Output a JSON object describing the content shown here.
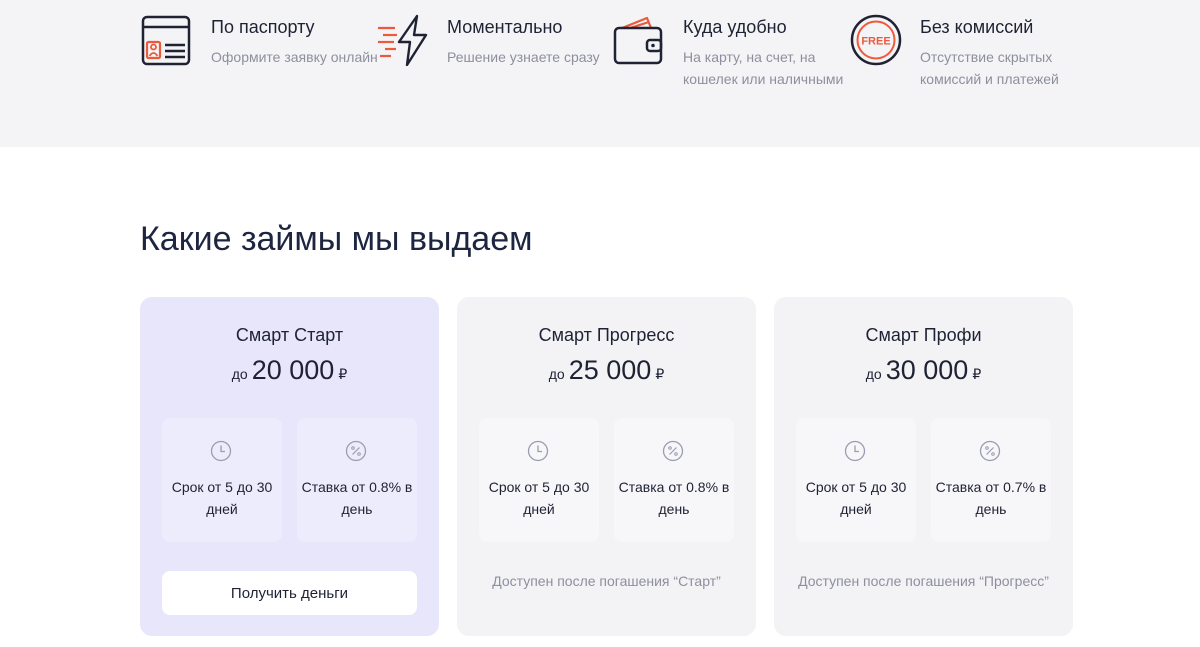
{
  "features": [
    {
      "icon": "passport-icon",
      "title": "По паспорту",
      "desc": "Оформите заявку онлайн"
    },
    {
      "icon": "lightning-icon",
      "title": "Моментально",
      "desc": "Решение узнаете сразу"
    },
    {
      "icon": "wallet-icon",
      "title": "Куда удобно",
      "desc": "На карту, на счет, на кошелек или наличными"
    },
    {
      "icon": "free-badge-icon",
      "title": "Без комиссий",
      "desc": "Отсутствие скрытых комиссий и платежей"
    }
  ],
  "free_badge_text": "FREE",
  "section_title": "Какие займы мы выдаем",
  "loans": [
    {
      "name": "Смарт Старт",
      "prefix": "до",
      "amount": "20 000",
      "currency": "₽",
      "term": "Срок от 5 до 30 дней",
      "rate": "Ставка от 0.8% в день",
      "button": "Получить деньги"
    },
    {
      "name": "Смарт Прогресс",
      "prefix": "до",
      "amount": "25 000",
      "currency": "₽",
      "term": "Срок от 5 до 30 дней",
      "rate": "Ставка от 0.8% в день",
      "availability": "Доступен после погашения “Старт”"
    },
    {
      "name": "Смарт Профи",
      "prefix": "до",
      "amount": "30 000",
      "currency": "₽",
      "term": "Срок от 5 до 30 дней",
      "rate": "Ставка от 0.7% в день",
      "availability": "Доступен после погашения “Прогресс”"
    }
  ],
  "colors": {
    "accent_red": "#ec5a3c",
    "dark": "#1f2233",
    "muted": "#8d8f9c",
    "active_card": "#e7e6fb",
    "card": "#f3f3f6"
  }
}
